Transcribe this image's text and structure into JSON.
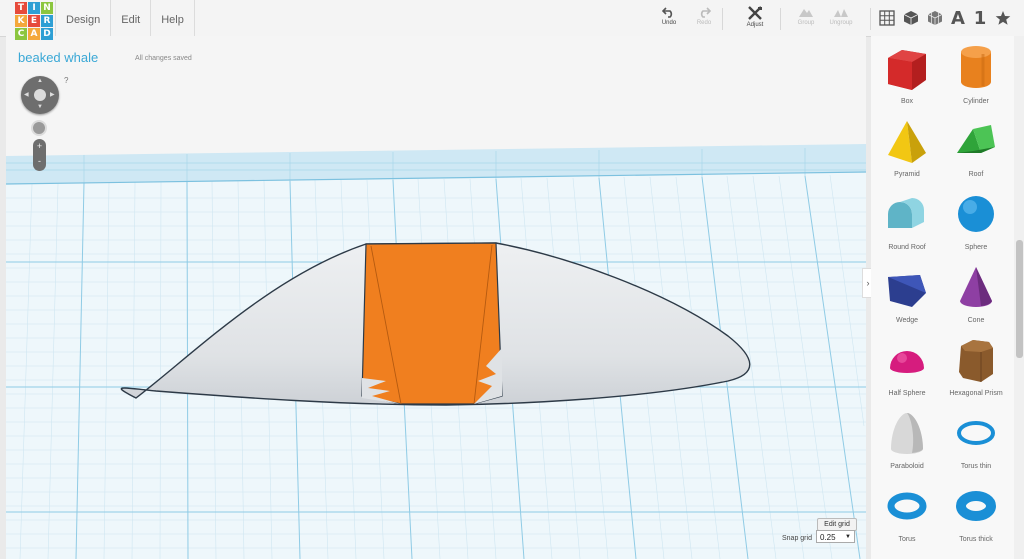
{
  "app": {
    "logo_letters": [
      "T",
      "I",
      "N",
      "K",
      "E",
      "R",
      "C",
      "A",
      "D"
    ],
    "logo_colors": [
      "#e64a3b",
      "#2e9fd4",
      "#8cc63f",
      "#f4a83a",
      "#e64a3b",
      "#2e9fd4",
      "#8cc63f",
      "#f4a83a",
      "#2e9fd4"
    ]
  },
  "menu": [
    "Design",
    "Edit",
    "Help"
  ],
  "toolbar": {
    "undo": "Undo",
    "redo": "Redo",
    "adjust": "Adjust",
    "group": "Group",
    "ungroup": "Ungroup",
    "text_tool": "A",
    "number_tool": "1"
  },
  "project": {
    "title": "beaked whale",
    "status": "All changes saved"
  },
  "view": {
    "help": "?",
    "zoom_in": "+",
    "zoom_out": "-"
  },
  "grid": {
    "edit_label": "Edit grid",
    "snap_label": "Snap grid",
    "snap_value": "0.25"
  },
  "sidebar": {
    "collapse_glyph": "›",
    "shapes": [
      {
        "label": "Box",
        "color": "#d42a2a"
      },
      {
        "label": "Cylinder",
        "color": "#e8811e"
      },
      {
        "label": "Pyramid",
        "color": "#f2c713"
      },
      {
        "label": "Roof",
        "color": "#2fa43a"
      },
      {
        "label": "Round Roof",
        "color": "#74c7d6"
      },
      {
        "label": "Sphere",
        "color": "#1a8fd6"
      },
      {
        "label": "Wedge",
        "color": "#2c3e8f"
      },
      {
        "label": "Cone",
        "color": "#8e3fa3"
      },
      {
        "label": "Half Sphere",
        "color": "#d61c7e"
      },
      {
        "label": "Hexagonal Prism",
        "color": "#8a5a2c"
      },
      {
        "label": "Paraboloid",
        "color": "#d8d8d8"
      },
      {
        "label": "Torus thin",
        "color": "#1a8fd6"
      },
      {
        "label": "Torus",
        "color": "#1a8fd6"
      },
      {
        "label": "Torus thick",
        "color": "#1a8fd6"
      }
    ]
  },
  "colors": {
    "accent": "#3aa8d6",
    "band": "#cfe8f4",
    "object_gray": "#e3e5e8",
    "object_orange": "#f07f1f"
  }
}
